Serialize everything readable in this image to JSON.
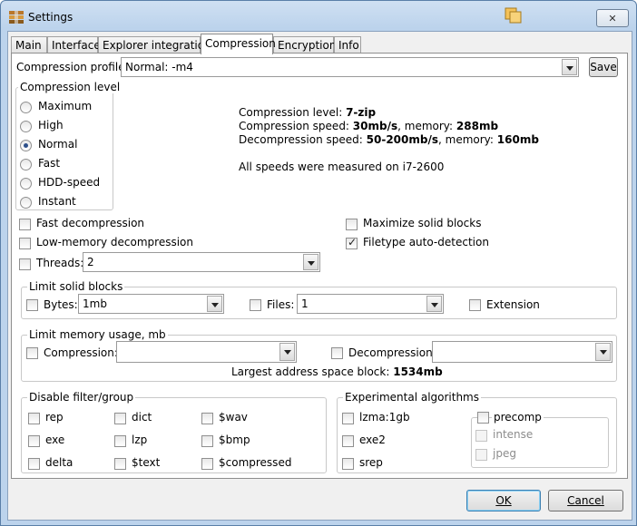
{
  "window": {
    "title": "Settings",
    "close_glyph": "✕"
  },
  "tabs": [
    "Main",
    "Interface",
    "Explorer integration",
    "Compression",
    "Encryption",
    "Info"
  ],
  "profile": {
    "label": "Compression profile:",
    "value": "Normal: -m4",
    "save_label": "Save"
  },
  "level_group": {
    "title": "Compression level",
    "options": [
      "Maximum",
      "High",
      "Normal",
      "Fast",
      "HDD-speed",
      "Instant"
    ],
    "selected": "Normal"
  },
  "info": {
    "level_label": "Compression level: ",
    "level_value": "7-zip",
    "cspeed_label": "Compression speed: ",
    "cspeed_value": "30mb/s",
    "cmem_label": ", memory: ",
    "cmem_value": "288mb",
    "dspeed_label": "Decompression speed: ",
    "dspeed_value": "50-200mb/s",
    "dmem_label": ", memory: ",
    "dmem_value": "160mb",
    "note": "All speeds were measured on i7-2600"
  },
  "options": {
    "fast_decompression": "Fast decompression",
    "low_memory_decompression": "Low-memory decompression",
    "threads_label": "Threads:",
    "threads_value": "2",
    "maximize_solid_blocks": "Maximize solid blocks",
    "filetype_auto_detection": "Filetype auto-detection"
  },
  "solid_blocks": {
    "title": "Limit solid blocks",
    "bytes_label": "Bytes:",
    "bytes_value": "1mb",
    "files_label": "Files:",
    "files_value": "1",
    "extension_label": "Extension"
  },
  "memory": {
    "title": "Limit memory usage, mb",
    "compression_label": "Compression:",
    "compression_value": "",
    "decompression_label": "Decompression:",
    "decompression_value": "",
    "address_label": "Largest address space block: ",
    "address_value": "1534mb"
  },
  "filters": {
    "title": "Disable filter/group",
    "items": [
      "rep",
      "dict",
      "$wav",
      "exe",
      "lzp",
      "$bmp",
      "delta",
      "$text",
      "$compressed"
    ]
  },
  "experimental": {
    "title": "Experimental algorithms",
    "items": [
      "lzma:1gb",
      "exe2",
      "srep"
    ],
    "precomp_label": "precomp",
    "precomp_items": [
      "intense",
      "jpeg"
    ]
  },
  "footer": {
    "ok_label": "OK",
    "cancel_label": "Cancel"
  }
}
